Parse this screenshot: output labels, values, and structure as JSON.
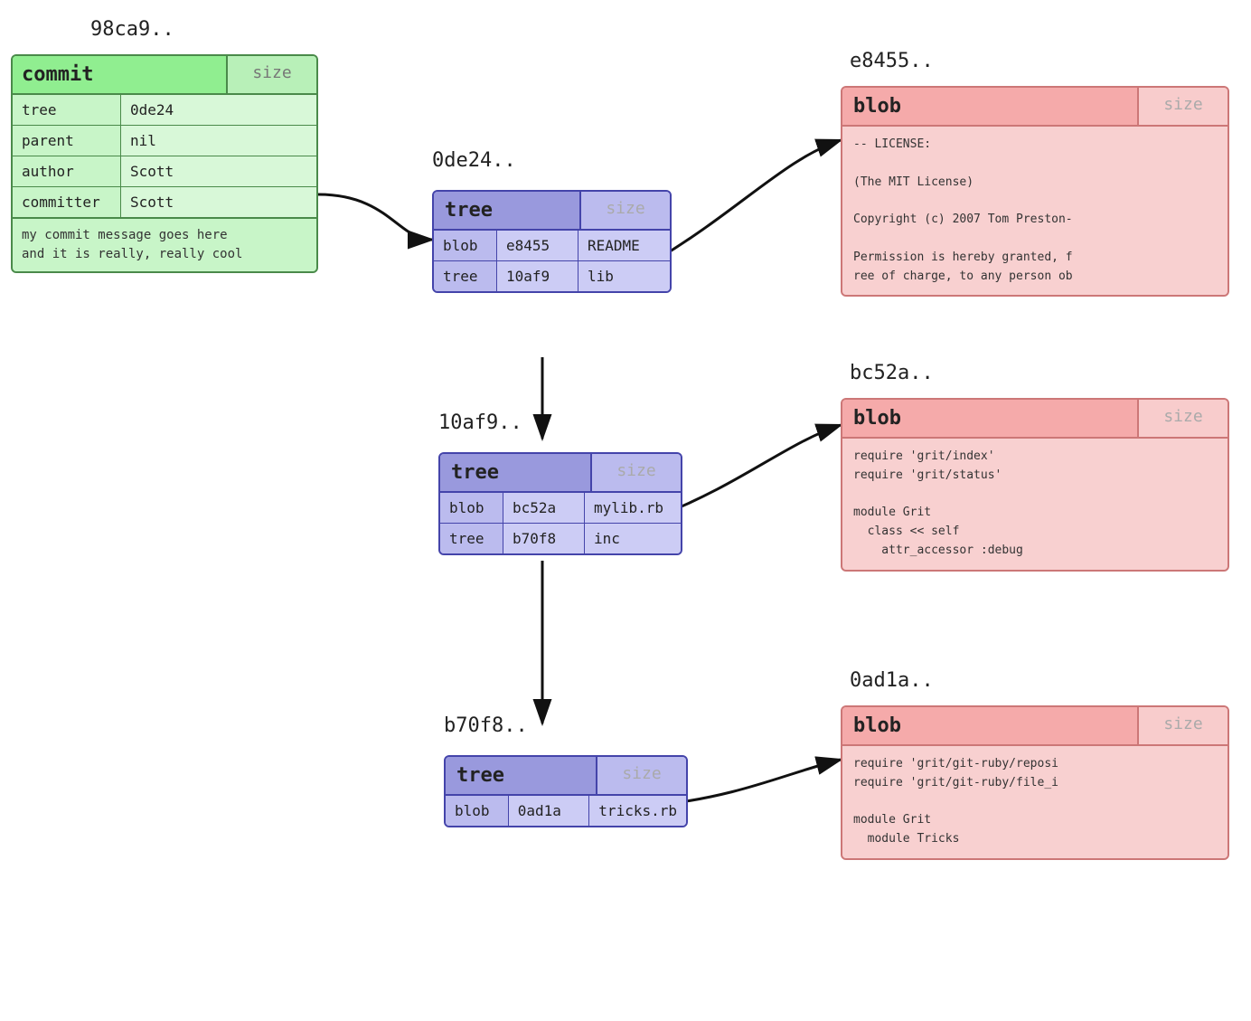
{
  "commit": {
    "label": "98ca9..",
    "type": "commit",
    "size": "size",
    "rows": [
      {
        "key": "tree",
        "val": "0de24"
      },
      {
        "key": "parent",
        "val": "nil"
      },
      {
        "key": "author",
        "val": "Scott"
      },
      {
        "key": "committer",
        "val": "Scott"
      }
    ],
    "message": "my commit message goes here\nand it is really, really cool"
  },
  "tree1": {
    "label": "0de24..",
    "type": "tree",
    "size": "size",
    "rows": [
      {
        "type": "blob",
        "hash": "e8455",
        "name": "README"
      },
      {
        "type": "tree",
        "hash": "10af9",
        "name": "lib"
      }
    ]
  },
  "tree2": {
    "label": "10af9..",
    "type": "tree",
    "size": "size",
    "rows": [
      {
        "type": "blob",
        "hash": "bc52a",
        "name": "mylib.rb"
      },
      {
        "type": "tree",
        "hash": "b70f8",
        "name": "inc"
      }
    ]
  },
  "tree3": {
    "label": "b70f8..",
    "type": "tree",
    "size": "size",
    "rows": [
      {
        "type": "blob",
        "hash": "0ad1a",
        "name": "tricks.rb"
      }
    ]
  },
  "blob1": {
    "label": "e8455..",
    "type": "blob",
    "size": "size",
    "content": "-- LICENSE:\n\n(The MIT License)\n\nCopyright (c) 2007 Tom Preston-\n\nPermission is hereby granted, f\nree of charge, to any person ob"
  },
  "blob2": {
    "label": "bc52a..",
    "type": "blob",
    "size": "size",
    "content": "require 'grit/index'\nrequire 'grit/status'\n\nmodule Grit\n  class << self\n    attr_accessor :debug"
  },
  "blob3": {
    "label": "0ad1a..",
    "type": "blob",
    "size": "size",
    "content": "require 'grit/git-ruby/reposi\nrequire 'grit/git-ruby/file_i\n\nmodule Grit\n  module Tricks"
  }
}
